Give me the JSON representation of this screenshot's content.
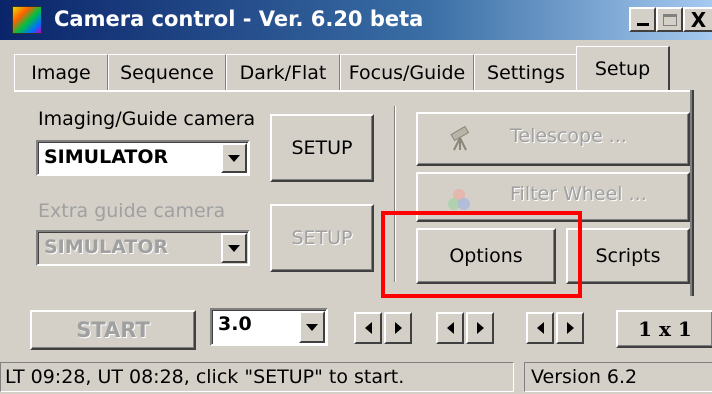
{
  "window": {
    "title": "Camera control - Ver. 6.20 beta",
    "controls": {
      "minimize": "_",
      "maximize": "□",
      "close": "X"
    }
  },
  "tabs": [
    {
      "label": "Image",
      "active": false
    },
    {
      "label": "Sequence",
      "active": false
    },
    {
      "label": "Dark/Flat",
      "active": false
    },
    {
      "label": "Focus/Guide",
      "active": false
    },
    {
      "label": "Settings",
      "active": false
    },
    {
      "label": "Setup",
      "active": true
    }
  ],
  "setup": {
    "imaging_camera_label": "Imaging/Guide camera",
    "imaging_camera_value": "SIMULATOR",
    "imaging_setup_label": "SETUP",
    "extra_camera_label": "Extra guide camera",
    "extra_camera_value": "SIMULATOR",
    "extra_setup_label": "SETUP",
    "telescope_label": "Telescope ...",
    "filter_wheel_label": "Filter Wheel ...",
    "options_label": "Options",
    "scripts_label": "Scripts"
  },
  "toolbar": {
    "start_label": "START",
    "exposure_value": "3.0",
    "binning_label": "1 x 1"
  },
  "status_bar": {
    "message": "LT 09:28,  UT 08:28,  click \"SETUP\" to start.",
    "version": "Version 6.2"
  },
  "colors": {
    "title_gradient_start": "#0a246a",
    "title_gradient_end": "#a6caf0",
    "face": "#d4d0c8",
    "disabled_text": "#a0a0a0",
    "highlight": "#ff0000"
  },
  "icons": {
    "telescope": "telescope-icon",
    "filter_wheel": "filter-wheel-icon"
  }
}
